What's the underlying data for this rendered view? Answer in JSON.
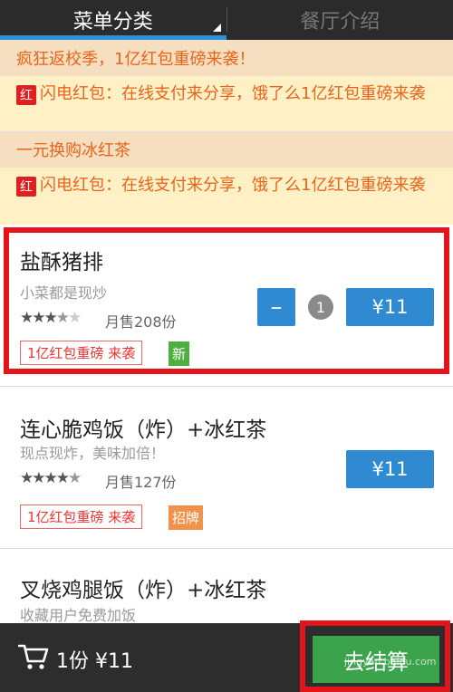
{
  "tabs": [
    {
      "label": "菜单分类"
    },
    {
      "label": "餐厅介绍"
    }
  ],
  "sections": [
    {
      "title": "疯狂返校季，1亿红包重磅来袭！",
      "promo_badge": "红",
      "promo_text": "闪电红包：在线支付来分享，饿了么1亿红包重磅来袭"
    },
    {
      "title": "一元换购冰红茶",
      "promo_badge": "红",
      "promo_text": "闪电红包：在线支付来分享，饿了么1亿红包重磅来袭"
    }
  ],
  "items": [
    {
      "name": "盐酥猪排",
      "desc": "小菜都是现炒",
      "rating": 3.5,
      "monthly": "月售208份",
      "tag": "1亿红包重磅 来袭",
      "badge": "新",
      "badge_color": "#4caf3f",
      "quantity": "1",
      "minus": "–",
      "price": "¥11"
    },
    {
      "name": "连心脆鸡饭（炸）+冰红茶",
      "desc": "现点现炸，美味加倍！",
      "rating": 4.5,
      "monthly": "月售127份",
      "tag": "1亿红包重磅 来袭",
      "badge": "招牌",
      "badge_color": "#f0924a",
      "price": "¥11"
    },
    {
      "name": "叉烧鸡腿饭（炸）+冰红茶",
      "desc": "收藏用户免费加饭"
    }
  ],
  "cart": {
    "summary": "1份 ¥11",
    "icon": "cart-icon"
  },
  "checkout": {
    "label": "去结算"
  },
  "watermark": {
    "text": "jingyan.baidu.com"
  },
  "colors": {
    "accent_blue": "#2f8ad2",
    "highlight_red": "#e4141b",
    "checkout_green": "#3aa34c",
    "promo_orange": "#e8641c"
  }
}
